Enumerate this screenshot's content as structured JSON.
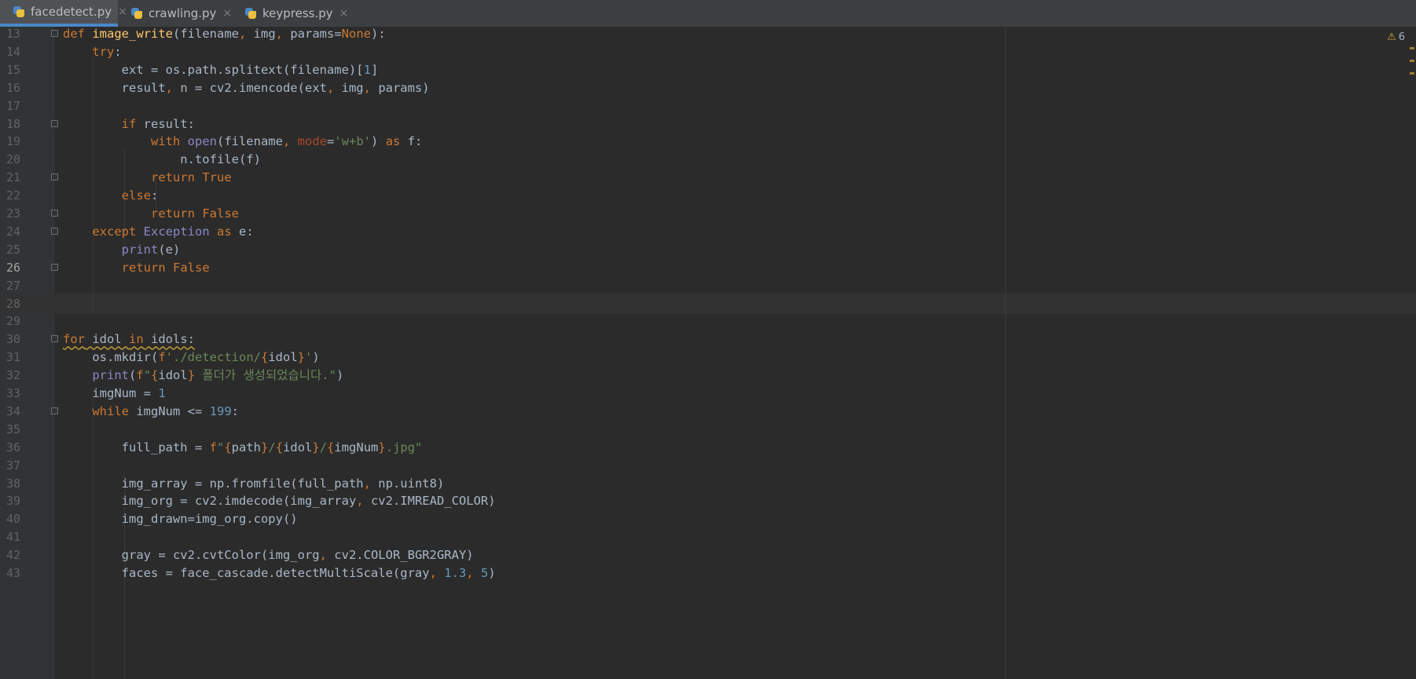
{
  "tabs": [
    {
      "label": "facedetect.py",
      "active": true,
      "icon": "python-file-icon"
    },
    {
      "label": "crawling.py",
      "active": false,
      "icon": "python-file-icon"
    },
    {
      "label": "keypress.py",
      "active": false,
      "icon": "python-file-icon"
    }
  ],
  "tab_close_glyph": "×",
  "warning": {
    "icon": "warning-icon",
    "count": "6"
  },
  "current_line": "26",
  "colors": {
    "keyword": "#cc7832",
    "function_name": "#ffc66d",
    "number": "#6897bb",
    "string": "#6a8759",
    "builtin": "#8888c6",
    "param_name": "#aa4926",
    "default_text": "#a9b7c6",
    "background": "#2b2b2b",
    "gutter": "#313335"
  },
  "lines": [
    {
      "num": "13",
      "code": "def image_write(filename, img, params=None):"
    },
    {
      "num": "14",
      "code": "    try:"
    },
    {
      "num": "15",
      "code": "        ext = os.path.splitext(filename)[1]"
    },
    {
      "num": "16",
      "code": "        result, n = cv2.imencode(ext, img, params)"
    },
    {
      "num": "17",
      "code": ""
    },
    {
      "num": "18",
      "code": "        if result:"
    },
    {
      "num": "19",
      "code": "            with open(filename, mode='w+b') as f:"
    },
    {
      "num": "20",
      "code": "                n.tofile(f)"
    },
    {
      "num": "21",
      "code": "            return True"
    },
    {
      "num": "22",
      "code": "        else:"
    },
    {
      "num": "23",
      "code": "            return False"
    },
    {
      "num": "24",
      "code": "    except Exception as e:"
    },
    {
      "num": "25",
      "code": "        print(e)"
    },
    {
      "num": "26",
      "code": "        return False"
    },
    {
      "num": "27",
      "code": ""
    },
    {
      "num": "28",
      "code": ""
    },
    {
      "num": "29",
      "code": ""
    },
    {
      "num": "30",
      "code": "for idol in idols:"
    },
    {
      "num": "31",
      "code": "    os.mkdir(f'./detection/{idol}')"
    },
    {
      "num": "32",
      "code": "    print(f\"{idol} 폴더가 생성되었습니다.\")"
    },
    {
      "num": "33",
      "code": "    imgNum = 1"
    },
    {
      "num": "34",
      "code": "    while imgNum <= 199:"
    },
    {
      "num": "35",
      "code": ""
    },
    {
      "num": "36",
      "code": "        full_path = f\"{path}/{idol}/{imgNum}.jpg\""
    },
    {
      "num": "37",
      "code": ""
    },
    {
      "num": "38",
      "code": "        img_array = np.fromfile(full_path, np.uint8)"
    },
    {
      "num": "39",
      "code": "        img_org = cv2.imdecode(img_array, cv2.IMREAD_COLOR)"
    },
    {
      "num": "40",
      "code": "        img_drawn=img_org.copy()"
    },
    {
      "num": "41",
      "code": ""
    },
    {
      "num": "42",
      "code": "        gray = cv2.cvtColor(img_org, cv2.COLOR_BGR2GRAY)"
    },
    {
      "num": "43",
      "code": "        faces = face_cascade.detectMultiScale(gray, 1.3, 5)"
    }
  ]
}
